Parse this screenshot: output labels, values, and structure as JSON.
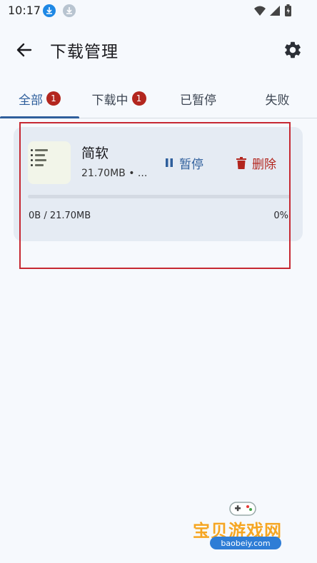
{
  "status_bar": {
    "time": "10:17",
    "icons": [
      "download-notification-icon",
      "download-notification-icon-muted",
      "wifi-icon",
      "signal-icon",
      "battery-icon"
    ]
  },
  "app_bar": {
    "title": "下载管理",
    "back_icon": "arrow-back-icon",
    "settings_icon": "gear-icon"
  },
  "tabs": [
    {
      "label": "全部",
      "badge": "1",
      "active": true
    },
    {
      "label": "下载中",
      "badge": "1",
      "active": false
    },
    {
      "label": "已暂停",
      "active": false
    },
    {
      "label": "失败",
      "active": false
    }
  ],
  "download_item": {
    "name": "简软",
    "size_info": "21.70MB • ...",
    "pause_label": "暂停",
    "delete_label": "删除",
    "progress_text": "0B / 21.70MB",
    "progress_percent": "0%",
    "progress_fraction": 0
  },
  "watermark": {
    "title": "宝贝游戏网",
    "url": "baobeiy.com"
  },
  "colors": {
    "background": "#f6f9fd",
    "accent": "#2f5f9c",
    "danger": "#b3261e",
    "card": "#e5ebf3",
    "highlight": "#c62832"
  }
}
